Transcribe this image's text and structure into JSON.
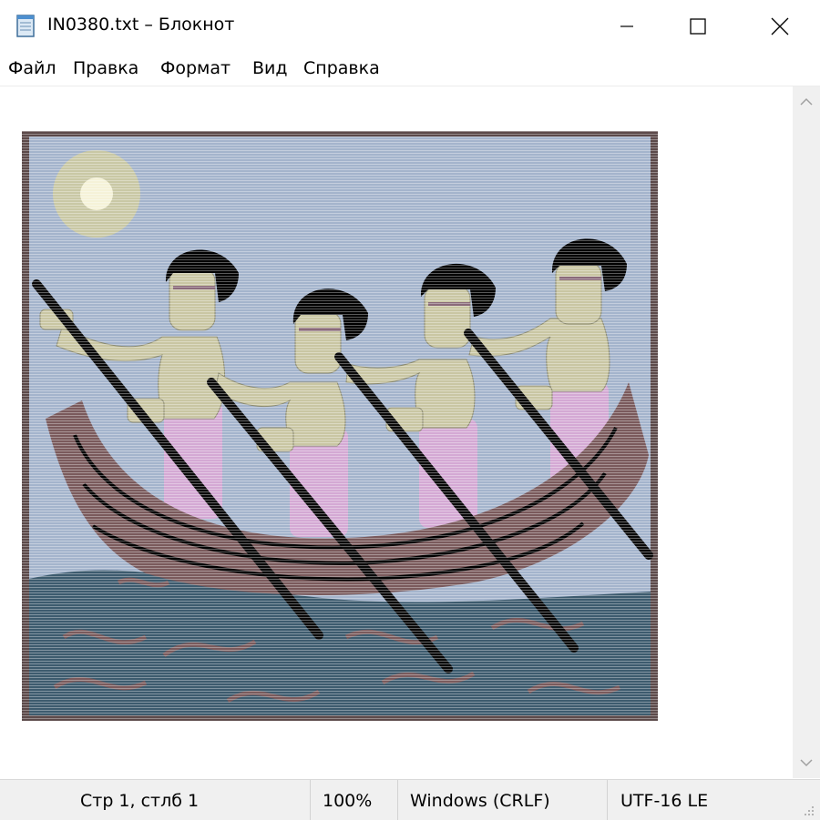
{
  "window": {
    "title": "IN0380.txt – Блокнот",
    "icon": "notepad-icon",
    "controls": [
      "minimize-icon",
      "maximize-icon",
      "close-icon"
    ]
  },
  "menu": [
    "Файл",
    "Правка",
    "Формат",
    "Вид",
    "Справка"
  ],
  "editor": {
    "content_kind": "ASCII-art picture rendered as text: four rowers in a wooden boat on wavy water under the moon"
  },
  "status": {
    "position": "Стр 1, стлб 1",
    "zoom": "100%",
    "line_endings": "Windows (CRLF)",
    "encoding": "UTF-16 LE"
  },
  "colors": {
    "sky": "#a4b4cc",
    "sea": "#3d5b6e",
    "boat": "#7a5a5c",
    "skin": "#c9c6a3",
    "robe": "#d4a9d4",
    "frame": "#5c4a4a"
  }
}
